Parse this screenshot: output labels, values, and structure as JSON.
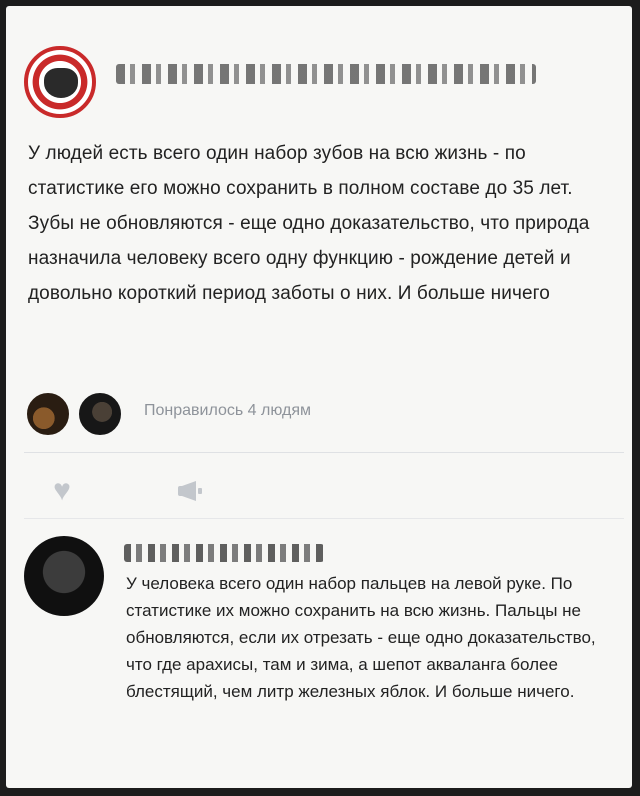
{
  "post": {
    "text": "У людей есть всего один набор зубов на всю жизнь - по статистике его можно сохранить в полном составе до 35 лет. Зубы не обновляются - еще одно доказательство, что природа назначила человеку всего одну функцию - рождение детей и довольно короткий период заботы о них. И больше ничего",
    "likes_text": "Понравилось 4 людям"
  },
  "actions": {
    "like_icon": "heart-icon",
    "share_icon": "share-icon"
  },
  "comment": {
    "text": "У человека всего один набор пальцев на левой руке. По статистике их можно сохранить на всю жизнь. Пальцы не обновляются, если их отрезать - еще одно доказательство, что где арахисы, там и зима, а шепот акваланга более блестящий, чем литр железных яблок. И больше ничего."
  },
  "colors": {
    "accent_red": "#c92a2a",
    "muted_text": "#8e939a"
  }
}
